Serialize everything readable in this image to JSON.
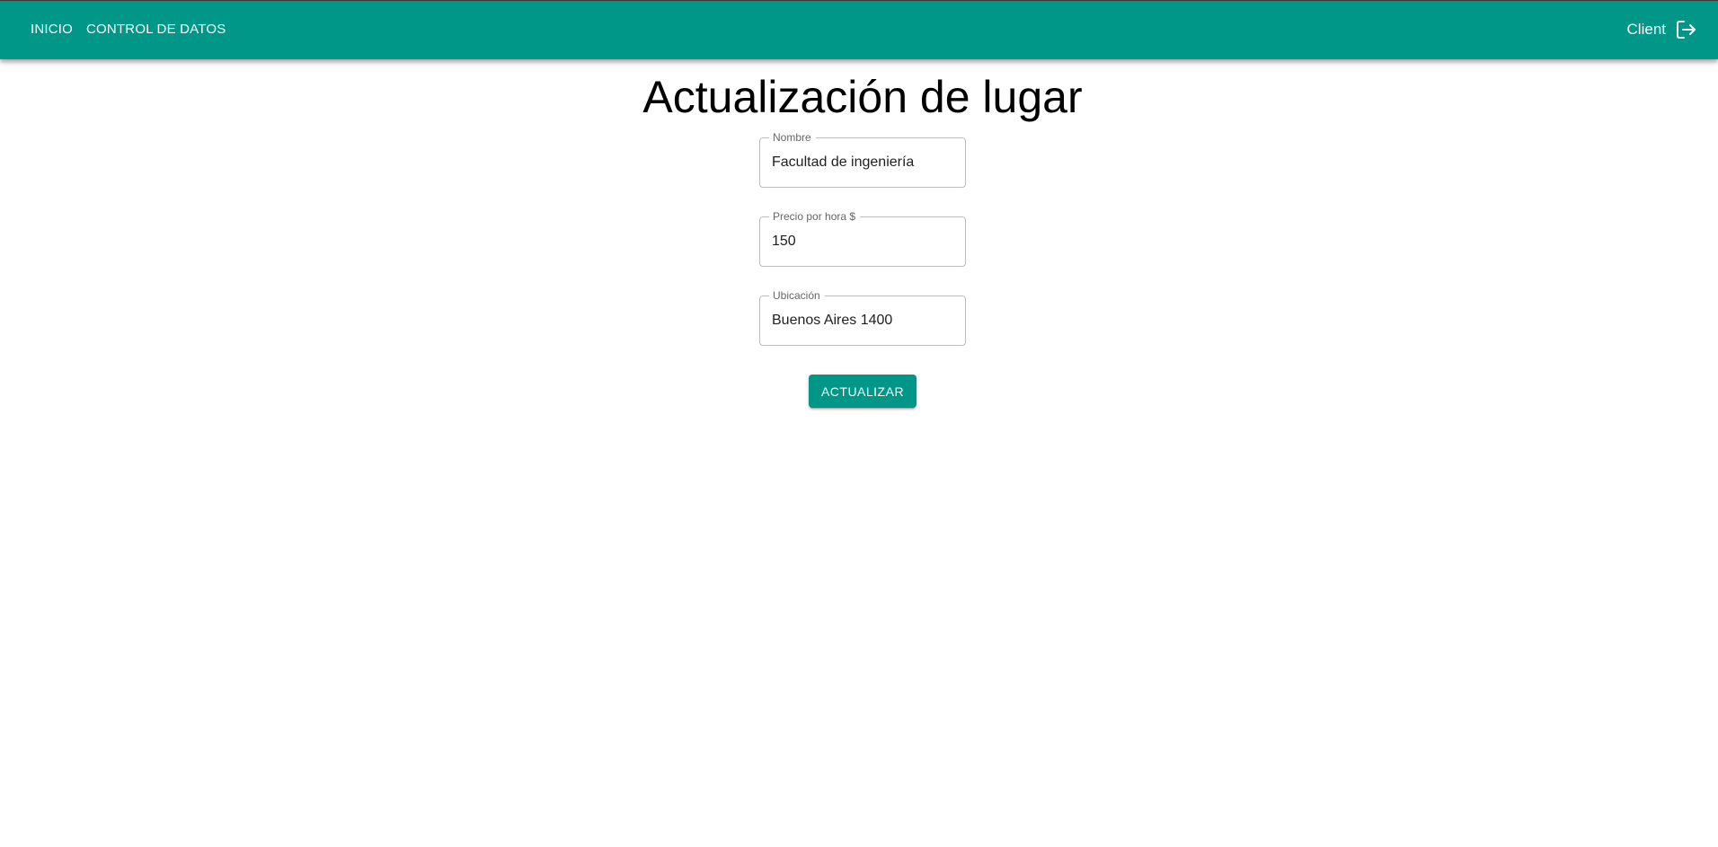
{
  "colors": {
    "primary": "#009688",
    "on_primary": "#ffffff",
    "field_border": "#bdbdbd",
    "label_text": "#666666"
  },
  "navbar": {
    "links": [
      {
        "label": "INICIO"
      },
      {
        "label": "CONTROL DE DATOS"
      }
    ],
    "user": {
      "name": "Client",
      "icon": "logout-icon"
    }
  },
  "main": {
    "title": "Actualización de lugar",
    "fields": [
      {
        "label": "Nombre",
        "value": "Facultad de ingeniería"
      },
      {
        "label": "Precio por hora $",
        "value": "150"
      },
      {
        "label": "Ubicación",
        "value": "Buenos Aires 1400"
      }
    ],
    "submit_label": "ACTUALIZAR"
  }
}
